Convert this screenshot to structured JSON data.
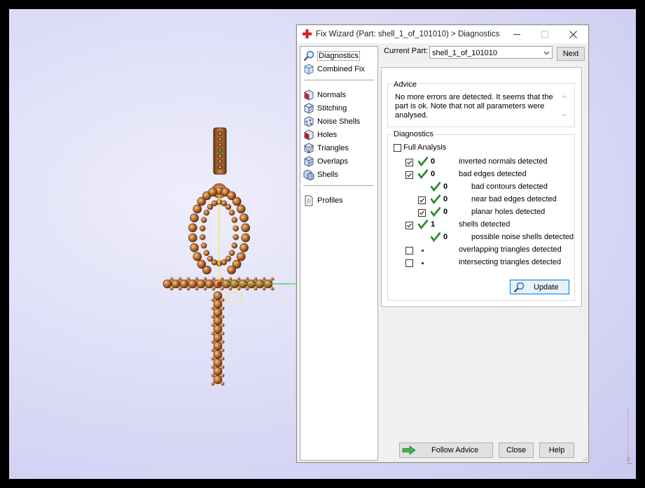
{
  "window": {
    "title": "Fix Wizard (Part: shell_1_of_101010) > Diagnostics"
  },
  "nav": {
    "items": [
      {
        "label": "Diagnostics",
        "icon": "magnifier-icon"
      },
      {
        "label": "Combined Fix",
        "icon": "cube-icon"
      },
      {
        "label": "Normals",
        "icon": "normals-cube-icon"
      },
      {
        "label": "Stitching",
        "icon": "stitching-cube-icon"
      },
      {
        "label": "Noise Shells",
        "icon": "noise-shells-icon"
      },
      {
        "label": "Holes",
        "icon": "holes-cube-icon"
      },
      {
        "label": "Triangles",
        "icon": "triangles-cube-icon"
      },
      {
        "label": "Overlaps",
        "icon": "overlaps-cube-icon"
      },
      {
        "label": "Shells",
        "icon": "shells-icon"
      },
      {
        "label": "Profiles",
        "icon": "document-icon"
      }
    ]
  },
  "part": {
    "label": "Current Part:",
    "value": "shell_1_of_101010",
    "next_label": "Next"
  },
  "advice": {
    "title": "Advice",
    "text": "No more errors are detected. It seems that the part is ok. Note that not all parameters were analysed."
  },
  "diagnostics": {
    "title": "Diagnostics",
    "full_analysis_label": "Full Analysis",
    "full_analysis_checked": false,
    "rows": [
      {
        "checkbox": true,
        "checked": true,
        "status": "ok",
        "count": "0",
        "label": "inverted normals detected"
      },
      {
        "checkbox": true,
        "checked": true,
        "status": "ok",
        "count": "0",
        "label": "bad edges detected"
      },
      {
        "checkbox": false,
        "checked": false,
        "status": "ok",
        "count": "0",
        "label": "bad contours detected"
      },
      {
        "checkbox": true,
        "checked": true,
        "status": "ok",
        "count": "0",
        "label": "near bad edges detected"
      },
      {
        "checkbox": true,
        "checked": true,
        "status": "ok",
        "count": "0",
        "label": "planar holes detected"
      },
      {
        "checkbox": true,
        "checked": true,
        "status": "ok",
        "count": "1",
        "label": "shells detected"
      },
      {
        "checkbox": false,
        "checked": false,
        "status": "ok",
        "count": "0",
        "label": "possible noise shells detected"
      },
      {
        "checkbox": true,
        "checked": false,
        "status": "not-run",
        "count": "",
        "label": "overlapping triangles detected"
      },
      {
        "checkbox": true,
        "checked": false,
        "status": "not-run",
        "count": "",
        "label": "intersecting triangles detected"
      }
    ],
    "update_label": "Update"
  },
  "footer": {
    "follow_label": "Follow Advice",
    "close_label": "Close",
    "help_label": "Help"
  },
  "colors": {
    "check_green": "#1f8a2a",
    "model_bronze": "#b8692a",
    "viewport_bg": "#dadaf6",
    "accent_blue": "#0078d7"
  }
}
